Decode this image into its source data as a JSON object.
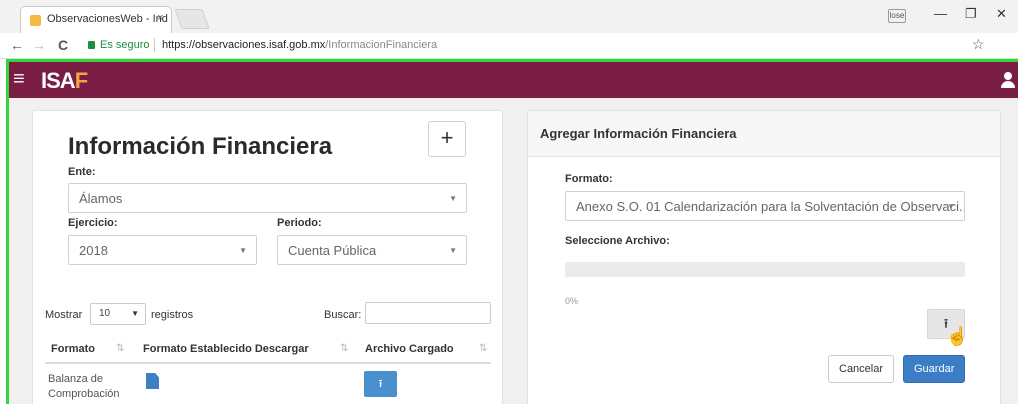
{
  "browser": {
    "tab_title": "ObservacionesWeb - Ind",
    "tab_close": "×",
    "address": {
      "secure_label": "Es seguro",
      "url_base": "https://observaciones.isaf.gob.mx",
      "url_path": "/InformacionFinanciera"
    },
    "nav": {
      "back": "←",
      "forward": "→",
      "reload": "C"
    },
    "star": "☆",
    "profile": "lose",
    "window": {
      "minimize": "—",
      "maximize": "❐",
      "close": "✕"
    }
  },
  "appbar": {
    "menu": "≡",
    "logo_main": "ISA",
    "logo_accent": "F"
  },
  "left": {
    "title": "Información Financiera",
    "add_label": "+",
    "ente_label": "Ente:",
    "ente_value": "Álamos",
    "ejercicio_label": "Ejercicio:",
    "ejercicio_value": "2018",
    "periodo_label": "Periodo:",
    "periodo_value": "Cuenta Pública",
    "mostrar": "Mostrar",
    "page_size": "10",
    "registros": "registros",
    "buscar": "Buscar:",
    "columns": [
      "Formato",
      "Formato Establecido Descargar",
      "Archivo Cargado"
    ],
    "rows": [
      {
        "formato": "Balanza de Comprobación"
      }
    ]
  },
  "right": {
    "header": "Agregar Información Financiera",
    "formato_label": "Formato:",
    "formato_value": "Anexo S.O. 01 Calendarización para la Solventación de Observaci...",
    "archivo_label": "Seleccione Archivo:",
    "progress_text": "0%",
    "progress": 0,
    "cancel_label": "Cancelar",
    "save_label": "Guardar"
  }
}
